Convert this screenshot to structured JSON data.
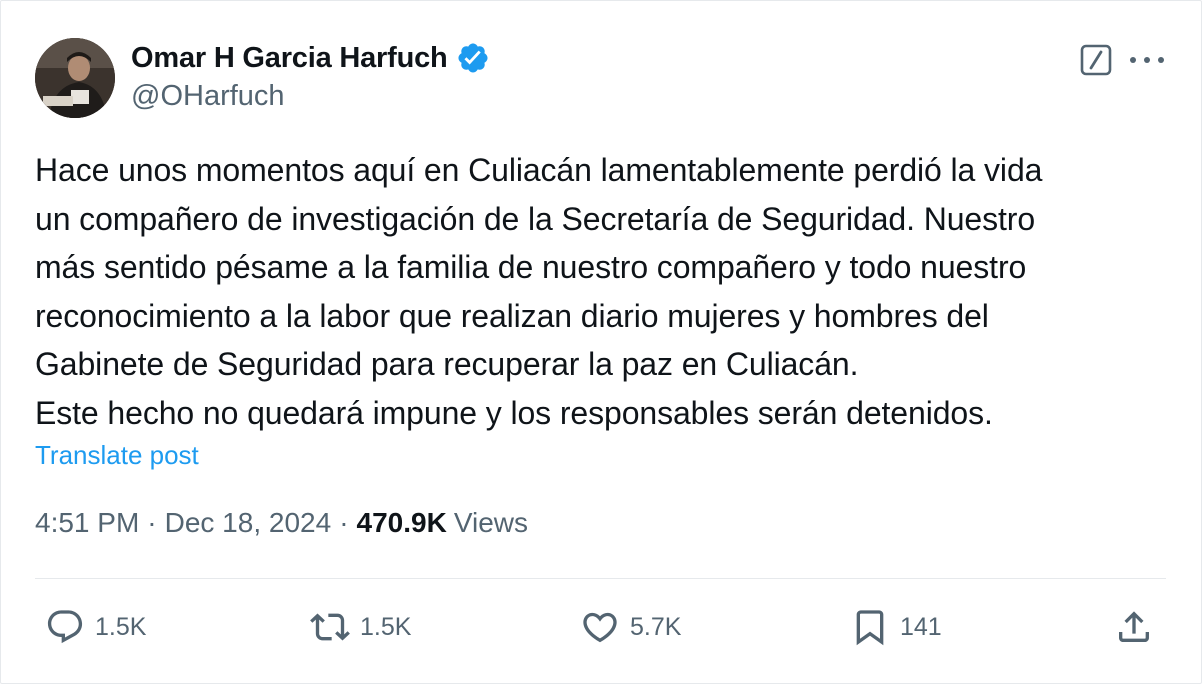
{
  "author": {
    "display_name": "Omar H Garcia Harfuch",
    "handle": "@OHarfuch",
    "verified": true
  },
  "tweet": {
    "lines": [
      "Hace unos momentos aquí en Culiacán lamentablemente perdió la vida",
      "un compañero de investigación de la Secretaría de Seguridad. Nuestro",
      "más sentido pésame a la familia de nuestro compañero y todo nuestro",
      "reconocimiento a la labor que realizan diario mujeres y hombres del",
      "Gabinete de Seguridad para recuperar la paz en Culiacán.",
      "Este hecho no quedará impune y los responsables serán detenidos."
    ],
    "translate_label": "Translate post"
  },
  "meta": {
    "time": "4:51 PM",
    "separator": "·",
    "date": "Dec 18, 2024",
    "views_count": "470.9K",
    "views_label": "Views"
  },
  "actions": {
    "replies": "1.5K",
    "reposts": "1.5K",
    "likes": "5.7K",
    "bookmarks": "141"
  },
  "icons": {
    "verified": "verified-badge-icon",
    "grok": "grok-icon",
    "more": "more-icon",
    "reply": "reply-icon",
    "repost": "repost-icon",
    "like": "heart-icon",
    "bookmark": "bookmark-icon",
    "share": "share-icon"
  },
  "colors": {
    "text": "#0f1419",
    "secondary": "#536471",
    "link": "#1d9bf0",
    "verified": "#1d9bf0",
    "divider": "#e6e9ec"
  }
}
